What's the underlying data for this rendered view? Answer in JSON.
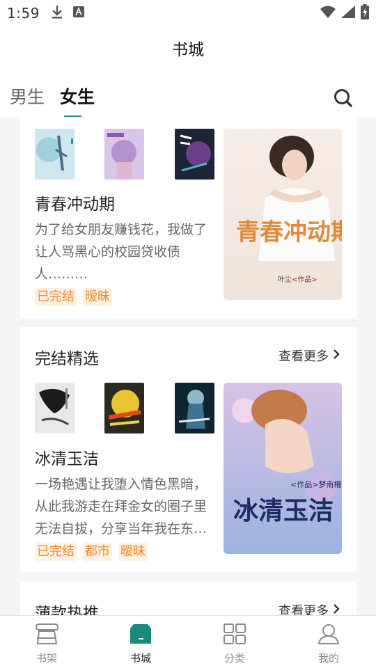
{
  "status_bar": {
    "time": "1:59"
  },
  "header": {
    "title": "书城"
  },
  "tabs": [
    {
      "label": "男生",
      "active": false
    },
    {
      "label": "女生",
      "active": true
    }
  ],
  "cards": [
    {
      "book": {
        "title": "青春冲动期",
        "description": "为了给女朋友赚钱花，我做了让人骂黑心的校园贷收债人………",
        "tags": [
          "已完结",
          "暧昧"
        ],
        "cover_text": "青春冲动期",
        "cover_author": "叶尘<作品>"
      }
    },
    {
      "section_title": "完结精选",
      "more_label": "查看更多",
      "book": {
        "title": "冰清玉洁",
        "description": "一场艳遇让我堕入情色黑暗，从此我游走在拜金女的圈子里无法自拔，分享当年我在东…",
        "tags": [
          "已完结",
          "都市",
          "暧昧"
        ],
        "cover_text": "冰清玉洁",
        "cover_author": "<作品>梦南柵"
      }
    },
    {
      "section_title": "薄款热推",
      "more_label": "查看更多"
    }
  ],
  "bottom_nav": [
    {
      "label": "书架",
      "icon": "bookshelf-icon",
      "active": false
    },
    {
      "label": "书城",
      "icon": "bookstore-icon",
      "active": true
    },
    {
      "label": "分类",
      "icon": "category-grid-icon",
      "active": false
    },
    {
      "label": "我的",
      "icon": "profile-icon",
      "active": false
    }
  ],
  "colors": {
    "accent": "#1a8b7a",
    "tag_text": "#f08a2a",
    "tag_bg": "#fdf1e3"
  }
}
